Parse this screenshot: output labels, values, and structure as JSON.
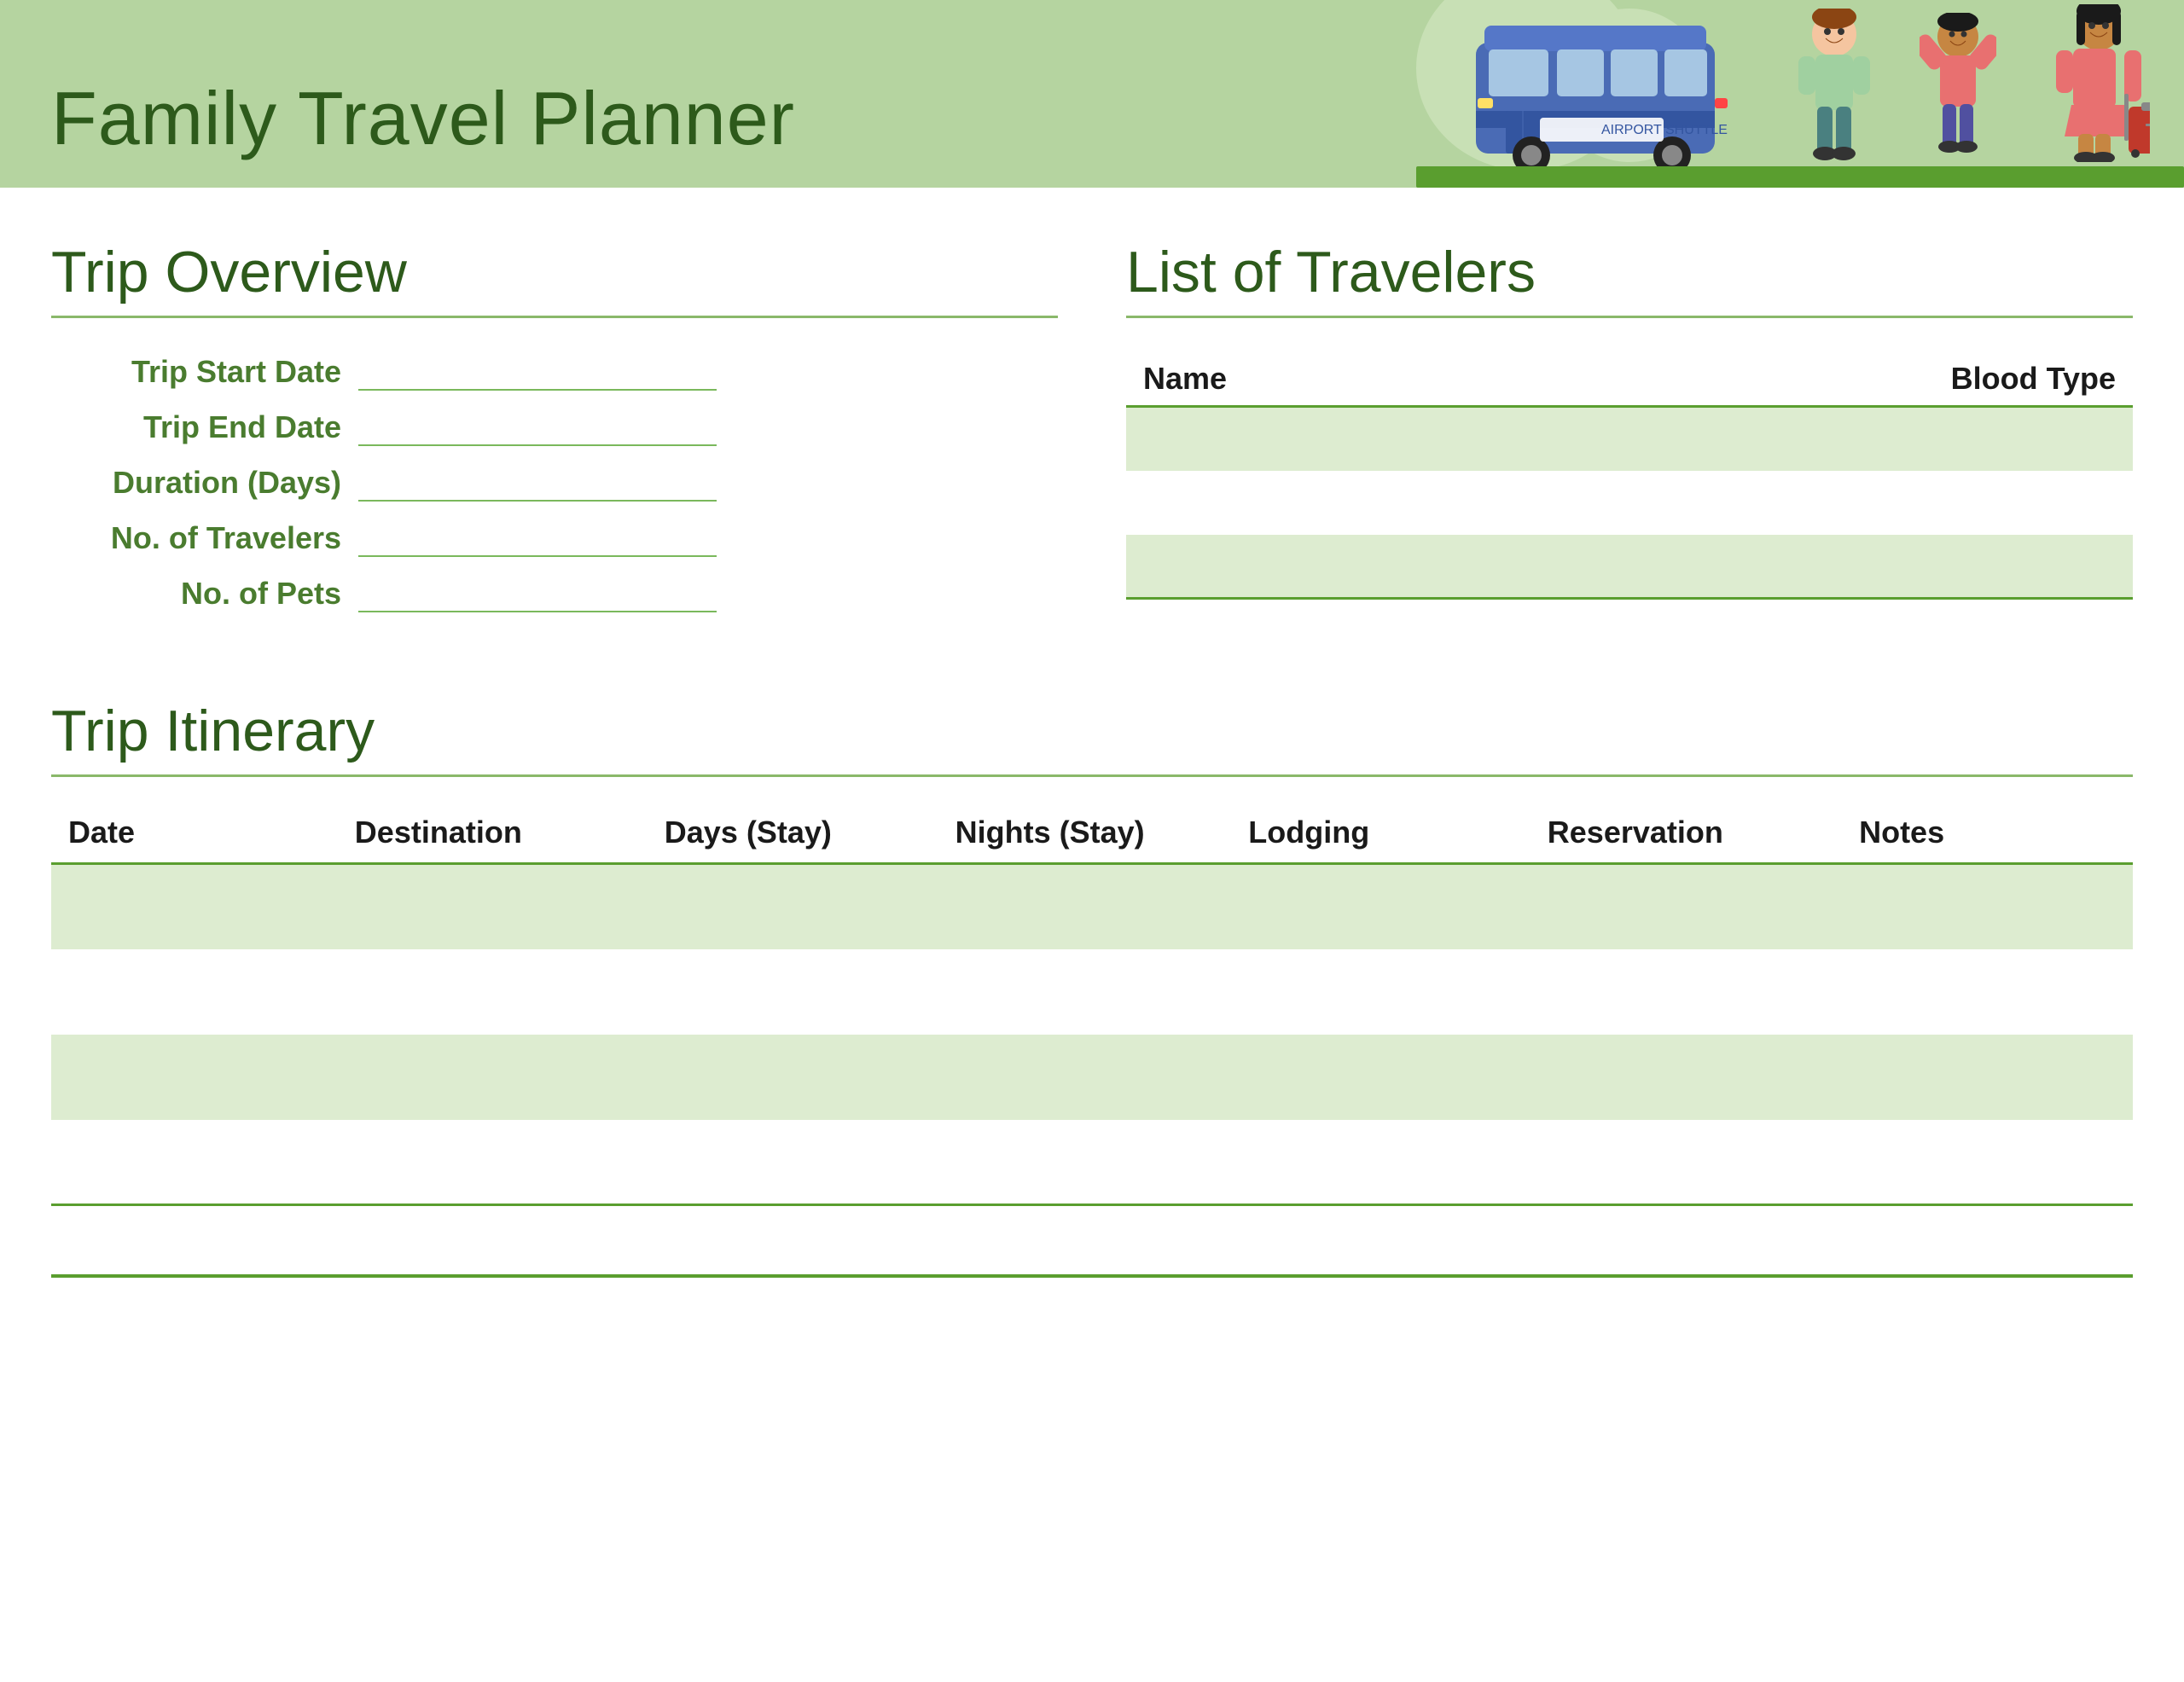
{
  "header": {
    "title": "Family Travel Planner",
    "background_color": "#b5d4a0"
  },
  "trip_overview": {
    "heading": "Trip Overview",
    "fields": [
      {
        "label": "Trip Start Date",
        "value": ""
      },
      {
        "label": "Trip End Date",
        "value": ""
      },
      {
        "label": "Duration (Days)",
        "value": ""
      },
      {
        "label": "No. of Travelers",
        "value": ""
      },
      {
        "label": "No. of Pets",
        "value": ""
      }
    ]
  },
  "travelers": {
    "heading": "List of Travelers",
    "columns": [
      "Name",
      "Blood Type"
    ],
    "rows": [
      {
        "name": "",
        "blood_type": ""
      },
      {
        "name": "",
        "blood_type": ""
      },
      {
        "name": "",
        "blood_type": ""
      }
    ]
  },
  "itinerary": {
    "heading": "Trip Itinerary",
    "columns": [
      "Date",
      "Destination",
      "Days (Stay)",
      "Nights (Stay)",
      "Lodging",
      "Reservation",
      "Notes"
    ],
    "rows": [
      {
        "date": "",
        "destination": "",
        "days_stay": "",
        "nights_stay": "",
        "lodging": "",
        "reservation": "",
        "notes": ""
      },
      {
        "date": "",
        "destination": "",
        "days_stay": "",
        "nights_stay": "",
        "lodging": "",
        "reservation": "",
        "notes": ""
      },
      {
        "date": "",
        "destination": "",
        "days_stay": "",
        "nights_stay": "",
        "lodging": "",
        "reservation": "",
        "notes": ""
      },
      {
        "date": "",
        "destination": "",
        "days_stay": "",
        "nights_stay": "",
        "lodging": "",
        "reservation": "",
        "notes": ""
      }
    ]
  }
}
